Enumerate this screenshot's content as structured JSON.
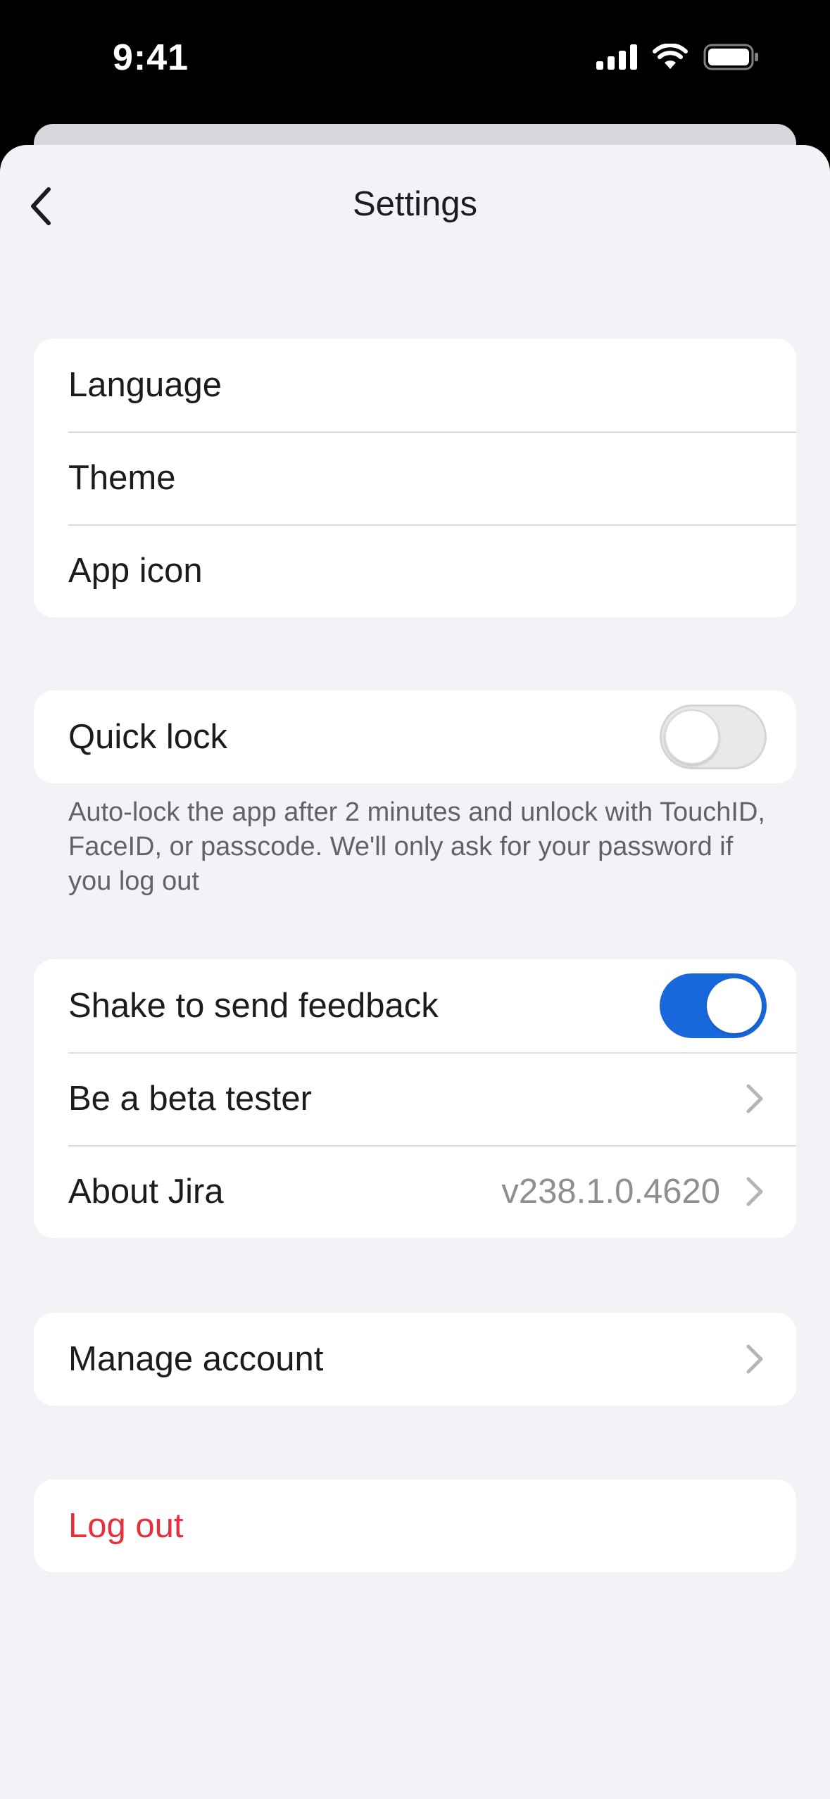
{
  "status_bar": {
    "time": "9:41",
    "icons": [
      "cellular-signal-icon",
      "wifi-icon",
      "battery-icon"
    ]
  },
  "nav": {
    "title": "Settings",
    "back_icon": "chevron-left-icon"
  },
  "groups": {
    "appearance": {
      "items": [
        {
          "label": "Language"
        },
        {
          "label": "Theme"
        },
        {
          "label": "App icon"
        }
      ]
    },
    "security": {
      "quick_lock": {
        "label": "Quick lock",
        "enabled": false
      },
      "footnote": "Auto-lock the app after 2 minutes and unlock with TouchID, FaceID, or passcode. We'll only ask for your password if you log out"
    },
    "feedback": {
      "shake": {
        "label": "Shake to send feedback",
        "enabled": true
      },
      "beta": {
        "label": "Be a beta tester"
      },
      "about": {
        "label": "About Jira",
        "value": "v238.1.0.4620"
      }
    },
    "account": {
      "manage": {
        "label": "Manage account"
      }
    },
    "logout": {
      "label": "Log out"
    }
  },
  "colors": {
    "background": "#f2f2f7",
    "card": "#ffffff",
    "toggle_on": "#1868db",
    "destructive": "#e8303c",
    "secondary_text": "#8e8e93"
  }
}
